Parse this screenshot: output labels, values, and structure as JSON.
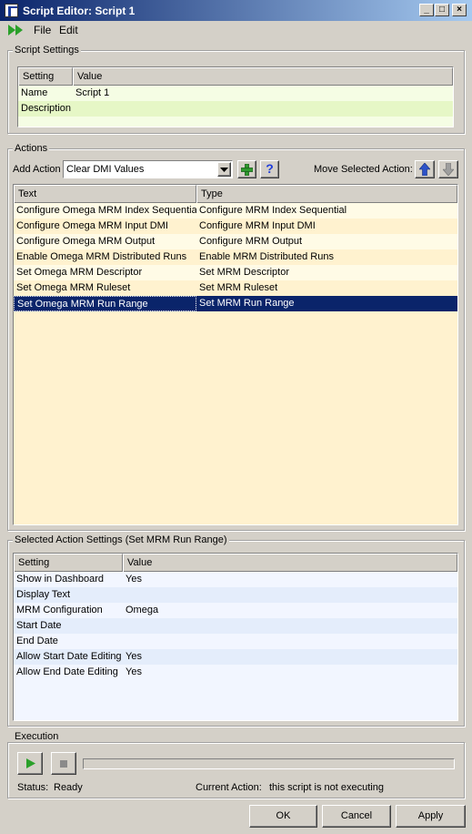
{
  "window": {
    "title": "Script Editor: Script 1",
    "minimize_glyph": "_",
    "maximize_glyph": "□",
    "close_glyph": "×"
  },
  "menu": {
    "run_icon": "run-script-icon",
    "items": [
      "File",
      "Edit"
    ]
  },
  "script_settings": {
    "title": "Script Settings",
    "columns": [
      "Setting",
      "Value"
    ],
    "rows": [
      {
        "setting": "Name",
        "value": "Script 1"
      },
      {
        "setting": "Description",
        "value": ""
      }
    ]
  },
  "actions": {
    "title": "Actions",
    "add_action_label": "Add Action",
    "add_action_selected": "Clear DMI Values",
    "add_button_glyph": "+",
    "help_button_glyph": "?",
    "move_label": "Move Selected Action:",
    "columns": [
      "Text",
      "Type"
    ],
    "rows": [
      {
        "text": "Configure Omega MRM Index Sequential",
        "type": "Configure MRM Index Sequential"
      },
      {
        "text": "Configure Omega MRM Input DMI",
        "type": "Configure MRM Input DMI"
      },
      {
        "text": "Configure Omega MRM Output",
        "type": "Configure MRM Output"
      },
      {
        "text": "Enable Omega MRM Distributed Runs",
        "type": "Enable MRM Distributed Runs"
      },
      {
        "text": "Set Omega MRM Descriptor",
        "type": "Set MRM Descriptor"
      },
      {
        "text": "Set Omega MRM Ruleset",
        "type": "Set MRM Ruleset"
      },
      {
        "text": "Set Omega MRM Run Range",
        "type": "Set MRM Run Range"
      }
    ],
    "selected_index": 6
  },
  "selected_action": {
    "title": "Selected Action Settings (Set MRM Run Range)",
    "columns": [
      "Setting",
      "Value"
    ],
    "rows": [
      {
        "setting": "Show in Dashboard",
        "value": "Yes"
      },
      {
        "setting": "Display Text",
        "value": ""
      },
      {
        "setting": "MRM Configuration",
        "value": "Omega"
      },
      {
        "setting": "Start Date",
        "value": ""
      },
      {
        "setting": "End Date",
        "value": ""
      },
      {
        "setting": "Allow Start Date Editing",
        "value": "Yes"
      },
      {
        "setting": "Allow End Date Editing",
        "value": "Yes"
      }
    ]
  },
  "execution": {
    "title": "Execution",
    "progress": 0,
    "status_label": "Status:",
    "status_value": "Ready",
    "current_action_label": "Current Action:",
    "current_action_value": "this script is not executing"
  },
  "buttons": {
    "ok": "OK",
    "cancel": "Cancel",
    "apply": "Apply"
  },
  "colors": {
    "selection": "#0a246a",
    "actions_row_a": "#fffbe6",
    "actions_row_b": "#fff2cf",
    "settings_row_a": "#f5fde4",
    "settings_row_b": "#e6f7c6",
    "sel_row_a": "#f2f6ff",
    "sel_row_b": "#e4edfb",
    "run_green": "#2aa02a"
  }
}
